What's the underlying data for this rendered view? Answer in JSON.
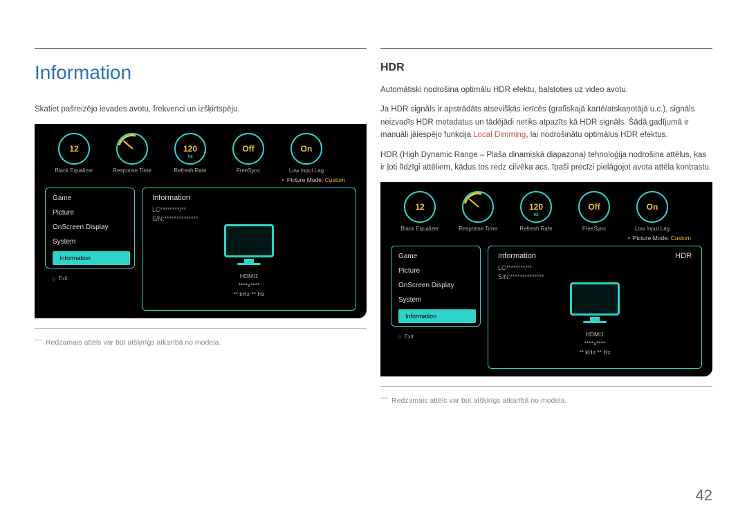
{
  "pageNumber": "42",
  "left": {
    "heading": "Information",
    "intro": "Skatiet pašreizējo ievades avotu, frekvenci un izšķirtspēju.",
    "note": "Redzamais attēls var būt atšķirīgs atkarībā no modeļa."
  },
  "right": {
    "heading": "HDR",
    "para1": "Automātiski nodrošina optimālu HDR efektu, balstoties uz video avotu.",
    "para2a": "Ja HDR signāls ir apstrādāts atsevišķās ierīcēs (grafiskajā kartē/atskaņotājā u.c.), signāls neizvadīs HDR metadatus un tādējādi netiks atpazīts kā HDR signāls. Šādā gadījumā ir manuāli jāiespējo funkcija ",
    "para2accent": "Local Dimming",
    "para2b": ", lai nodrošinātu optimālus HDR efektus.",
    "para3": "HDR (High Dynamic Range – Plaša dinamiskā diapazona) tehnoloģija nodrošina attēlus, kas ir ļoti līdzīgi attēliem, kādus tos redz cilvēka acs, īpaši precīzi pielāgojot avota attēla kontrastu.",
    "note": "Redzamais attēls var būt atšķirīgs atkarībā no modeļa."
  },
  "osd": {
    "gauges": {
      "be": {
        "value": "12",
        "label": "Black Equalizer"
      },
      "rt": {
        "label": "Response Time"
      },
      "rr": {
        "value": "120",
        "sub": "Hz",
        "label": "Refresh Rate"
      },
      "fs": {
        "value": "Off",
        "label": "FreeSync"
      },
      "lil": {
        "value": "On",
        "label": "Low Input Lag"
      }
    },
    "pictureModeLabel": "Picture Mode: ",
    "pictureModeValue": "Custom",
    "menu": {
      "items": [
        "Game",
        "Picture",
        "OnScreen Display",
        "System",
        "Information"
      ],
      "exit": "Exit"
    },
    "contentLeft": {
      "title": "Information",
      "lc": "LC********/**",
      "sn": "S/N:**************",
      "hdmi": "HDMI1",
      "res": "****x****",
      "freq": "** kHz ** Hz"
    },
    "contentRight": {
      "title": "Information",
      "extra": "HDR",
      "lc": "LC********/**",
      "sn": "S/N:**************",
      "hdmi": "HDMI1",
      "res": "****x****",
      "freq": "** kHz ** Hz"
    }
  }
}
